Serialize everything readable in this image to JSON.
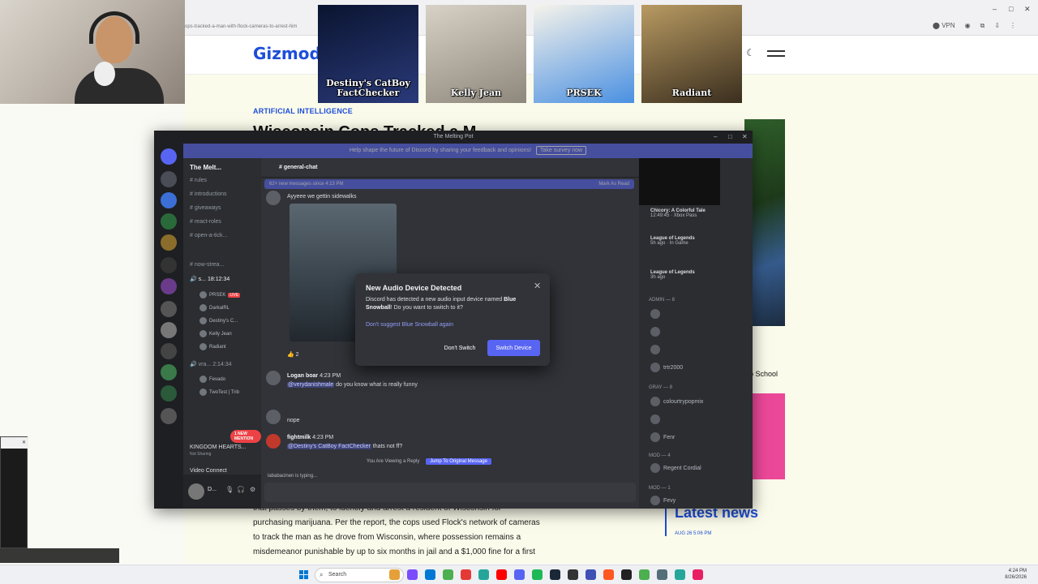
{
  "browser": {
    "url": "ops-tracked-a-man-with-flock-cameras-to-arrest-him",
    "vpn": "VPN"
  },
  "site": {
    "logo": "Gizmodo",
    "category": "ARTIFICIAL INTELLIGENCE",
    "headline_fragment": "Wisconsin Cops Tracked a M",
    "body": [
      "that passes by them, to identify and arrest a resident of Wisconsin for",
      "purchasing marijuana. Per the report, the cops used Flock's network of cameras",
      "to track the man as he drove from Wisconsin, where possession remains a",
      "misdemeanor punishable by up to six months in jail and a $1,000 fine for a first"
    ],
    "sidebar_text": "o School",
    "latest_news": "Latest news",
    "latest_date": "AUG 26   5:06 PM"
  },
  "viewer_cards": [
    {
      "name": "Destiny's CatBoy FactChecker",
      "colors": [
        "#0a1430",
        "#2a3a7a"
      ]
    },
    {
      "name": "Kelly Jean",
      "colors": [
        "#d8d2c6",
        "#8d877c"
      ]
    },
    {
      "name": "PRSEK",
      "colors": [
        "#f6f3ea",
        "#4a90e2"
      ]
    },
    {
      "name": "Radiant",
      "colors": [
        "#b89a62",
        "#3a2e1e"
      ]
    }
  ],
  "discord": {
    "window_title": "The Melting Pot",
    "banner": "Help shape the future of Discord by sharing your feedback and opinions!",
    "banner_button": "Take survey now",
    "server_name": "The Melt...",
    "channels": [
      {
        "label": "rules",
        "active": false
      },
      {
        "label": "introductions",
        "active": false
      },
      {
        "label": "giveaways",
        "active": false
      },
      {
        "label": "react-roles",
        "active": false
      },
      {
        "label": "open-a-tick...",
        "active": false
      },
      {
        "label": "now-strea...",
        "active": false
      }
    ],
    "voice_channel": "s...",
    "voice_timer": "18:12:34",
    "voice_users": [
      {
        "name": "PRSEK",
        "live": "LIVE"
      },
      {
        "name": "DarkalRL",
        "live": ""
      },
      {
        "name": "Destiny's C...",
        "live": ""
      },
      {
        "name": "Kelly Jean",
        "live": ""
      },
      {
        "name": "Radiant",
        "live": ""
      }
    ],
    "voice_channel2": "vra...",
    "voice_timer2": "2:14:34",
    "voice_users2": [
      "Fevado",
      "TwoTest | Trib"
    ],
    "new_mention": "1 NEW MENTION",
    "activity": {
      "title": "KINGDOM HEARTS...",
      "sub": "Not Sharing"
    },
    "video_connect": "Video Connect",
    "user_short": "D...",
    "chat_channel": "general-chat",
    "new_messages_text": "62+ new messages since 4:13 PM",
    "mark_as_read": "Mark As Read",
    "messages": [
      {
        "text": "Ayyeee we gettin sidewalks"
      },
      {
        "author": "Logan boar",
        "time": "4:23 PM",
        "mention": "@verydanishmale",
        "text": " do you know what is really funny"
      },
      {
        "text": "nope"
      },
      {
        "author": "fightmilk",
        "time": "4:23 PM",
        "mention": "@Destiny's CatBoy FactChecker",
        "text": " thats not ff?"
      }
    ],
    "reaction_count": "2",
    "reply_label": "You Are Viewing a Reply",
    "jump_label": "Jump To Original Message",
    "typing": "lababacinen is typing...",
    "members_activity": [
      {
        "title": "Chicory: A Colorful Tale",
        "sub": "12:49:45 · Xbox Pass"
      },
      {
        "title": "League of Legends",
        "sub": "5h ago · In Game"
      },
      {
        "title": "League of Legends",
        "sub": "3h ago"
      }
    ],
    "member_section_admin": "ADMIN — 8",
    "member_section_mod": "MOD — 4",
    "member_section_mod2": "mod — 1",
    "members": [
      "trtr2000",
      "colourtrypopmix",
      "Fenr",
      "Regent Cordial",
      "Fevy"
    ],
    "members_section_gray": "gray — 8"
  },
  "modal": {
    "title": "New Audio Device Detected",
    "text_before": "Discord has detected a new audio input device named ",
    "device": "Blue Snowball",
    "text_after": "! Do you want to switch to it?",
    "link": "Don't suggest Blue Snowball again",
    "dont_switch": "Don't Switch",
    "switch": "Switch Device"
  },
  "taskbar": {
    "search": "Search",
    "time": "4:24 PM",
    "date": "8/26/2026",
    "app_colors": [
      "#e5a03a",
      "#7c4dff",
      "#0078d4",
      "#4caf50",
      "#e53935",
      "#26a69a",
      "#ff0000",
      "#5865f2",
      "#1db954",
      "#1b2838",
      "#333333",
      "#3f51b5",
      "#ff5722",
      "#222222",
      "#4caf50",
      "#546e7a",
      "#26a69a",
      "#e91e63"
    ]
  }
}
